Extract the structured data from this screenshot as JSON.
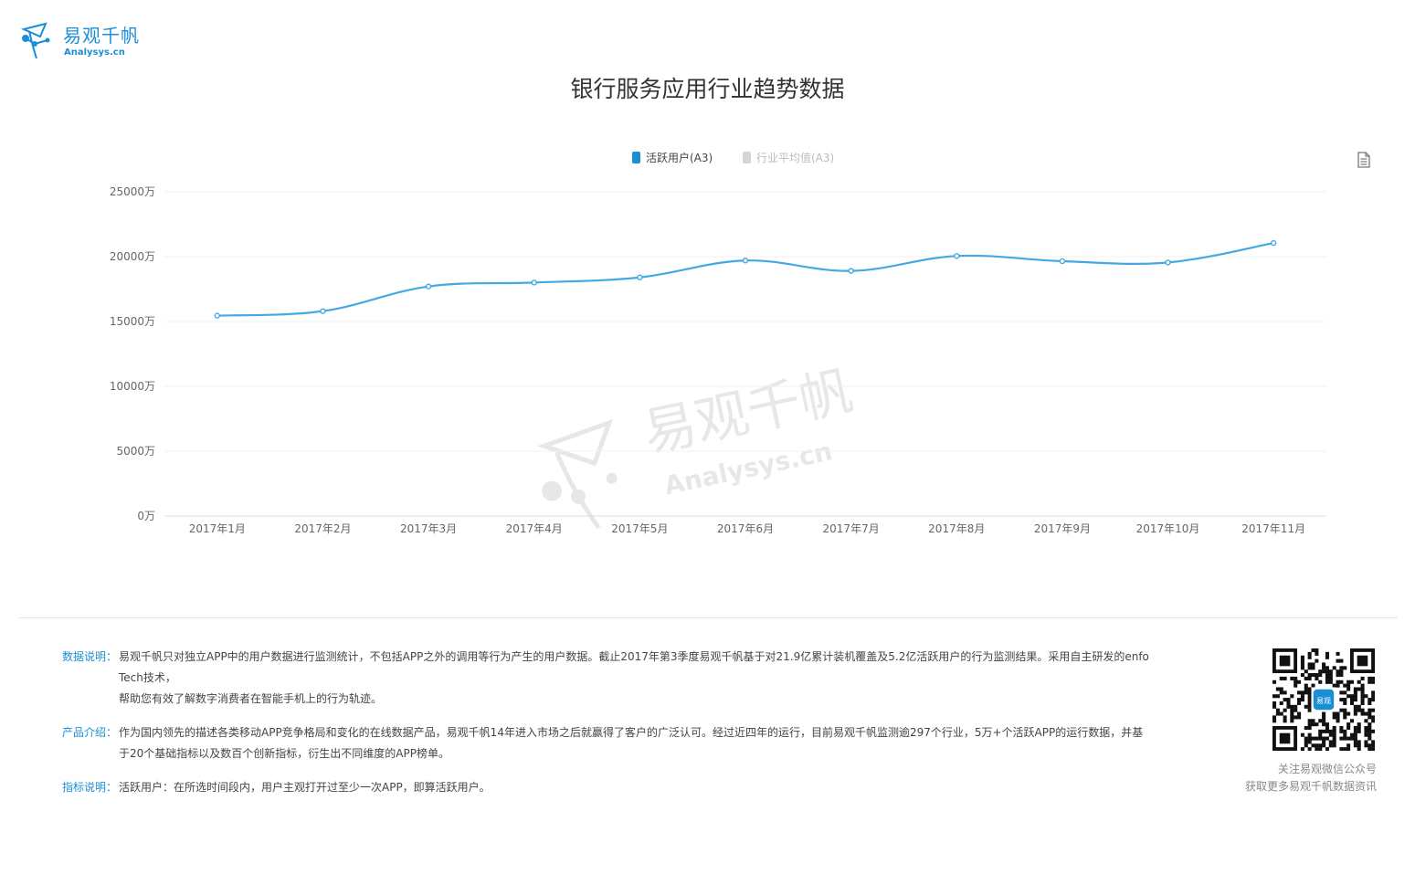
{
  "brand": {
    "name": "易观千帆",
    "domain": "Analysys.cn"
  },
  "page_title": "银行服务应用行业趋势数据",
  "watermark": {
    "name": "易观千帆",
    "domain": "Analysys.cn"
  },
  "icons": {
    "export": "document-icon",
    "logo": "analysys-logo-icon",
    "qr": "qr-code-icon"
  },
  "colors": {
    "primary_series": "#44a8e3",
    "secondary_series": "#d4d4d4",
    "brand": "#1b8fd6"
  },
  "chart_data": {
    "type": "line",
    "title": "",
    "xlabel": "",
    "ylabel": "",
    "categories": [
      "2017年1月",
      "2017年2月",
      "2017年3月",
      "2017年4月",
      "2017年5月",
      "2017年6月",
      "2017年7月",
      "2017年8月",
      "2017年9月",
      "2017年10月",
      "2017年11月"
    ],
    "series": [
      {
        "name": "活跃用户(A3)",
        "values": [
          15450,
          15800,
          17700,
          18000,
          18400,
          19700,
          18900,
          20050,
          19650,
          19550,
          21050
        ],
        "active": true
      },
      {
        "name": "行业平均值(A3)",
        "values": [],
        "active": false
      }
    ],
    "yticks": [
      "0万",
      "5000万",
      "10000万",
      "15000万",
      "20000万",
      "25000万"
    ],
    "ylim": [
      0,
      25000
    ],
    "grid": true,
    "legend_position": "top-center"
  },
  "notes": [
    {
      "label": "数据说明：",
      "lines": [
        "易观千帆只对独立APP中的用户数据进行监测统计，不包括APP之外的调用等行为产生的用户数据。截止2017年第3季度易观千帆基于对21.9亿累计装机覆盖及5.2亿活跃用户的行为监测结果。采用自主研发的enfoTech技术，",
        "帮助您有效了解数字消费者在智能手机上的行为轨迹。"
      ]
    },
    {
      "label": "产品介绍：",
      "lines": [
        "作为国内领先的描述各类移动APP竞争格局和变化的在线数据产品，易观千帆14年进入市场之后就赢得了客户的广泛认可。经过近四年的运行，目前易观千帆监测逾297个行业，5万+个活跃APP的运行数据，并基于20个基础指标以及数百个创新指标，衍生出不同维度的APP榜单。"
      ]
    },
    {
      "label": "指标说明：",
      "lines": [
        "活跃用户：在所选时间段内，用户主观打开过至少一次APP，即算活跃用户。"
      ]
    }
  ],
  "qr": {
    "caption_line1": "关注易观微信公众号",
    "caption_line2": "获取更多易观千帆数据资讯",
    "badge": "易观"
  }
}
